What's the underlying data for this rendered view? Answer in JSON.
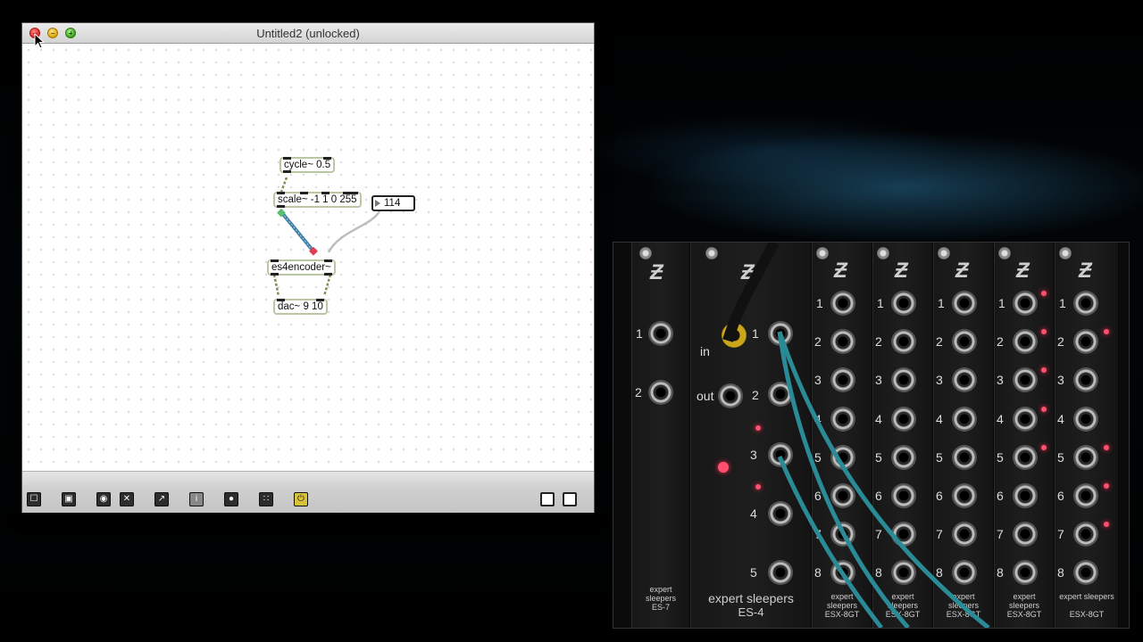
{
  "window": {
    "title": "Untitled2 (unlocked)"
  },
  "patch": {
    "objects": [
      {
        "name": "cycle-object",
        "text": "cycle~ 0.5"
      },
      {
        "name": "scale-object",
        "text": "scale~ -1 1 0 255"
      },
      {
        "name": "es4encoder-object",
        "text": "es4encoder~"
      },
      {
        "name": "dac-object",
        "text": "dac~ 9 10"
      }
    ],
    "number_box": {
      "value": "114"
    }
  },
  "toolbar": {
    "buttons": [
      {
        "name": "lock-icon"
      },
      {
        "name": "new-object-icon"
      },
      {
        "name": "palette-icon"
      },
      {
        "name": "close-x-icon"
      },
      {
        "name": "presentation-icon"
      },
      {
        "name": "inspector-icon"
      },
      {
        "name": "toggle-icon"
      },
      {
        "name": "grid-icon"
      },
      {
        "name": "audio-on-icon"
      },
      {
        "name": "left-pane-icon"
      },
      {
        "name": "right-pane-icon"
      }
    ]
  },
  "hardware": {
    "panel1": {
      "labels": [
        "1",
        "2"
      ],
      "brand": "expert sleepers",
      "model": "ES-7"
    },
    "panel2": {
      "labels": [
        "in",
        "out",
        "1",
        "2",
        "3",
        "4",
        "5"
      ],
      "brand": "expert sleepers",
      "model": "ES-4"
    },
    "jack_numbers": [
      "1",
      "2",
      "3",
      "4",
      "5",
      "6",
      "7",
      "8"
    ],
    "panel3": {
      "brand": "expert sleepers",
      "model": "ESX-8GT"
    },
    "panel4": {
      "brand": "expert sleepers",
      "model": "ESX-8GT"
    },
    "panel5": {
      "brand": "expert sleepers",
      "model": "ESX-8GT"
    },
    "panel6": {
      "brand": "expert sleepers",
      "model": "ESX-8GT"
    },
    "panel7": {
      "brand": "expert sleepers",
      "model": "ESX-8GT"
    }
  },
  "colors": {
    "patchcord_signal": "#3f7fa6",
    "object_border": "#b9c7a2",
    "led": "#ff5070"
  }
}
